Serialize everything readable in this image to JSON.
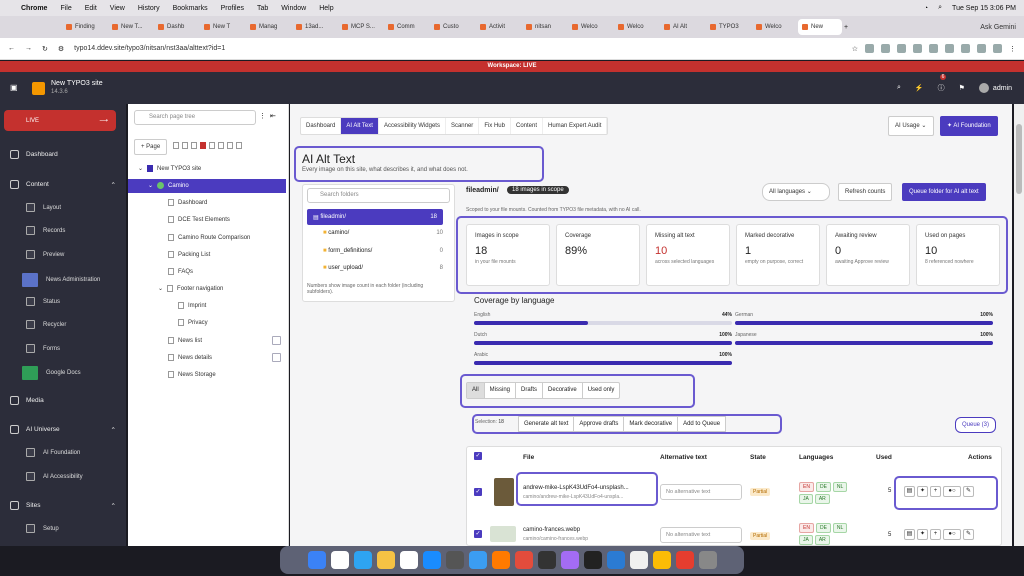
{
  "mac": {
    "apple": "",
    "app": "Chrome",
    "menus": [
      "File",
      "Edit",
      "View",
      "History",
      "Bookmarks",
      "Profiles",
      "Tab",
      "Window",
      "Help"
    ],
    "datetime": "Tue Sep 15  3:06 PM"
  },
  "browser": {
    "tabs": [
      "Finding",
      "New T...",
      "Dashb",
      "New T",
      "Manag",
      "13ad...",
      "MCP S...",
      "Comm",
      "Custo",
      "Activit",
      "nitsan",
      "Welco",
      "Welco",
      "AI Alt",
      "TYPO3",
      "Welco",
      "New"
    ],
    "ask_gemini": "Ask Gemini",
    "url": "typo14.ddev.site/typo3/nitsan/nst3aa/alttext?id=1"
  },
  "workspace": "Workspace: LIVE",
  "topbar": {
    "site_name": "New TYPO3 site",
    "version": "14.3.6",
    "notif_count": "6",
    "user": "admin"
  },
  "sidebar": {
    "live_label": "LIVE",
    "dashboard": "Dashboard",
    "content": "Content",
    "content_items": [
      "Layout",
      "Records",
      "Preview",
      "News Administration",
      "Status",
      "Recycler",
      "Forms",
      "Google Docs"
    ],
    "media": "Media",
    "ai_universe": "AI Universe",
    "ai_items": [
      "AI Foundation",
      "AI Accessibility"
    ],
    "sites": "Sites",
    "sites_items": [
      "Setup"
    ]
  },
  "tree": {
    "search_placeholder": "Search page tree",
    "new_page": "+ Page",
    "root": "New TYPO3 site",
    "selected": "Camino",
    "pages": [
      "Dashboard",
      "DCE Test Elements",
      "Camino Route Comparison",
      "Packing List",
      "FAQs",
      "Footer navigation",
      "Imprint",
      "Privacy",
      "News list",
      "News details",
      "News Storage"
    ]
  },
  "main": {
    "tabs": [
      "Dashboard",
      "AI Alt Text",
      "Accessibility Widgets",
      "Scanner",
      "Fix Hub",
      "Content",
      "Human Expert Audit"
    ],
    "usage_select": "AI Usage",
    "foundation_btn": "AI Foundation",
    "title": "AI Alt Text",
    "subtitle": "Every image on this site, what describes it, and what does not.",
    "folder_search": "Search folders",
    "folders": [
      {
        "name": "fileadmin/",
        "count": "18"
      },
      {
        "name": "camino/",
        "count": "10"
      },
      {
        "name": "form_definitions/",
        "count": "0"
      },
      {
        "name": "user_upload/",
        "count": "8"
      }
    ],
    "folder_note": "Numbers show image count in each folder (including subfolders).",
    "path": "fileadmin/",
    "scope_badge": "18 images in scope",
    "lang_select": "All languages",
    "refresh": "Refresh counts",
    "queue_folder": "Queue folder for AI alt text",
    "scope_note": "Scoped to your file mounts. Counted from TYPO3 file metadata, with no AI call.",
    "stats": [
      {
        "label": "Images in scope",
        "value": "18",
        "sub": "in your file mounts"
      },
      {
        "label": "Coverage",
        "value": "89%",
        "sub": ""
      },
      {
        "label": "Missing alt text",
        "value": "10",
        "sub": "across selected languages"
      },
      {
        "label": "Marked decorative",
        "value": "1",
        "sub": "empty on purpose, correct"
      },
      {
        "label": "Awaiting review",
        "value": "0",
        "sub": "awaiting Approve review"
      },
      {
        "label": "Used on pages",
        "value": "10",
        "sub": "8 referenced nowhere"
      }
    ],
    "coverage_title": "Coverage by language",
    "coverage": [
      {
        "lang": "English",
        "pct": "44%",
        "value": 44
      },
      {
        "lang": "German",
        "pct": "100%",
        "value": 100
      },
      {
        "lang": "Dutch",
        "pct": "100%",
        "value": 100
      },
      {
        "lang": "Japanese",
        "pct": "100%",
        "value": 100
      },
      {
        "lang": "Arabic",
        "pct": "100%",
        "value": 100
      }
    ],
    "filters": [
      "All",
      "Missing",
      "Drafts",
      "Decorative",
      "Used only"
    ],
    "selection_label": "Selection:",
    "selection_count": "18",
    "bulk": [
      "Generate alt text",
      "Approve drafts",
      "Mark decorative",
      "Add to Queue"
    ],
    "queue": "Queue (3)",
    "columns": [
      "File",
      "Alternative text",
      "State",
      "Languages",
      "Used",
      "Actions"
    ],
    "rows": [
      {
        "file": "andrew-mike-LspK43UdFo4-unsplash...",
        "path": "camino/andrew-mike-LspK43UdFo4-unspla...",
        "alt_placeholder": "No alternative text",
        "state": "Partial",
        "langs": [
          "EN",
          "DE",
          "NL",
          "JA",
          "AR"
        ],
        "used": "5"
      },
      {
        "file": "camino-frances.webp",
        "path": "camino/camino-frances.webp",
        "alt_placeholder": "No alternative text",
        "state": "Partial",
        "langs": [
          "EN",
          "DE",
          "NL",
          "JA",
          "AR"
        ],
        "used": "5"
      }
    ]
  }
}
